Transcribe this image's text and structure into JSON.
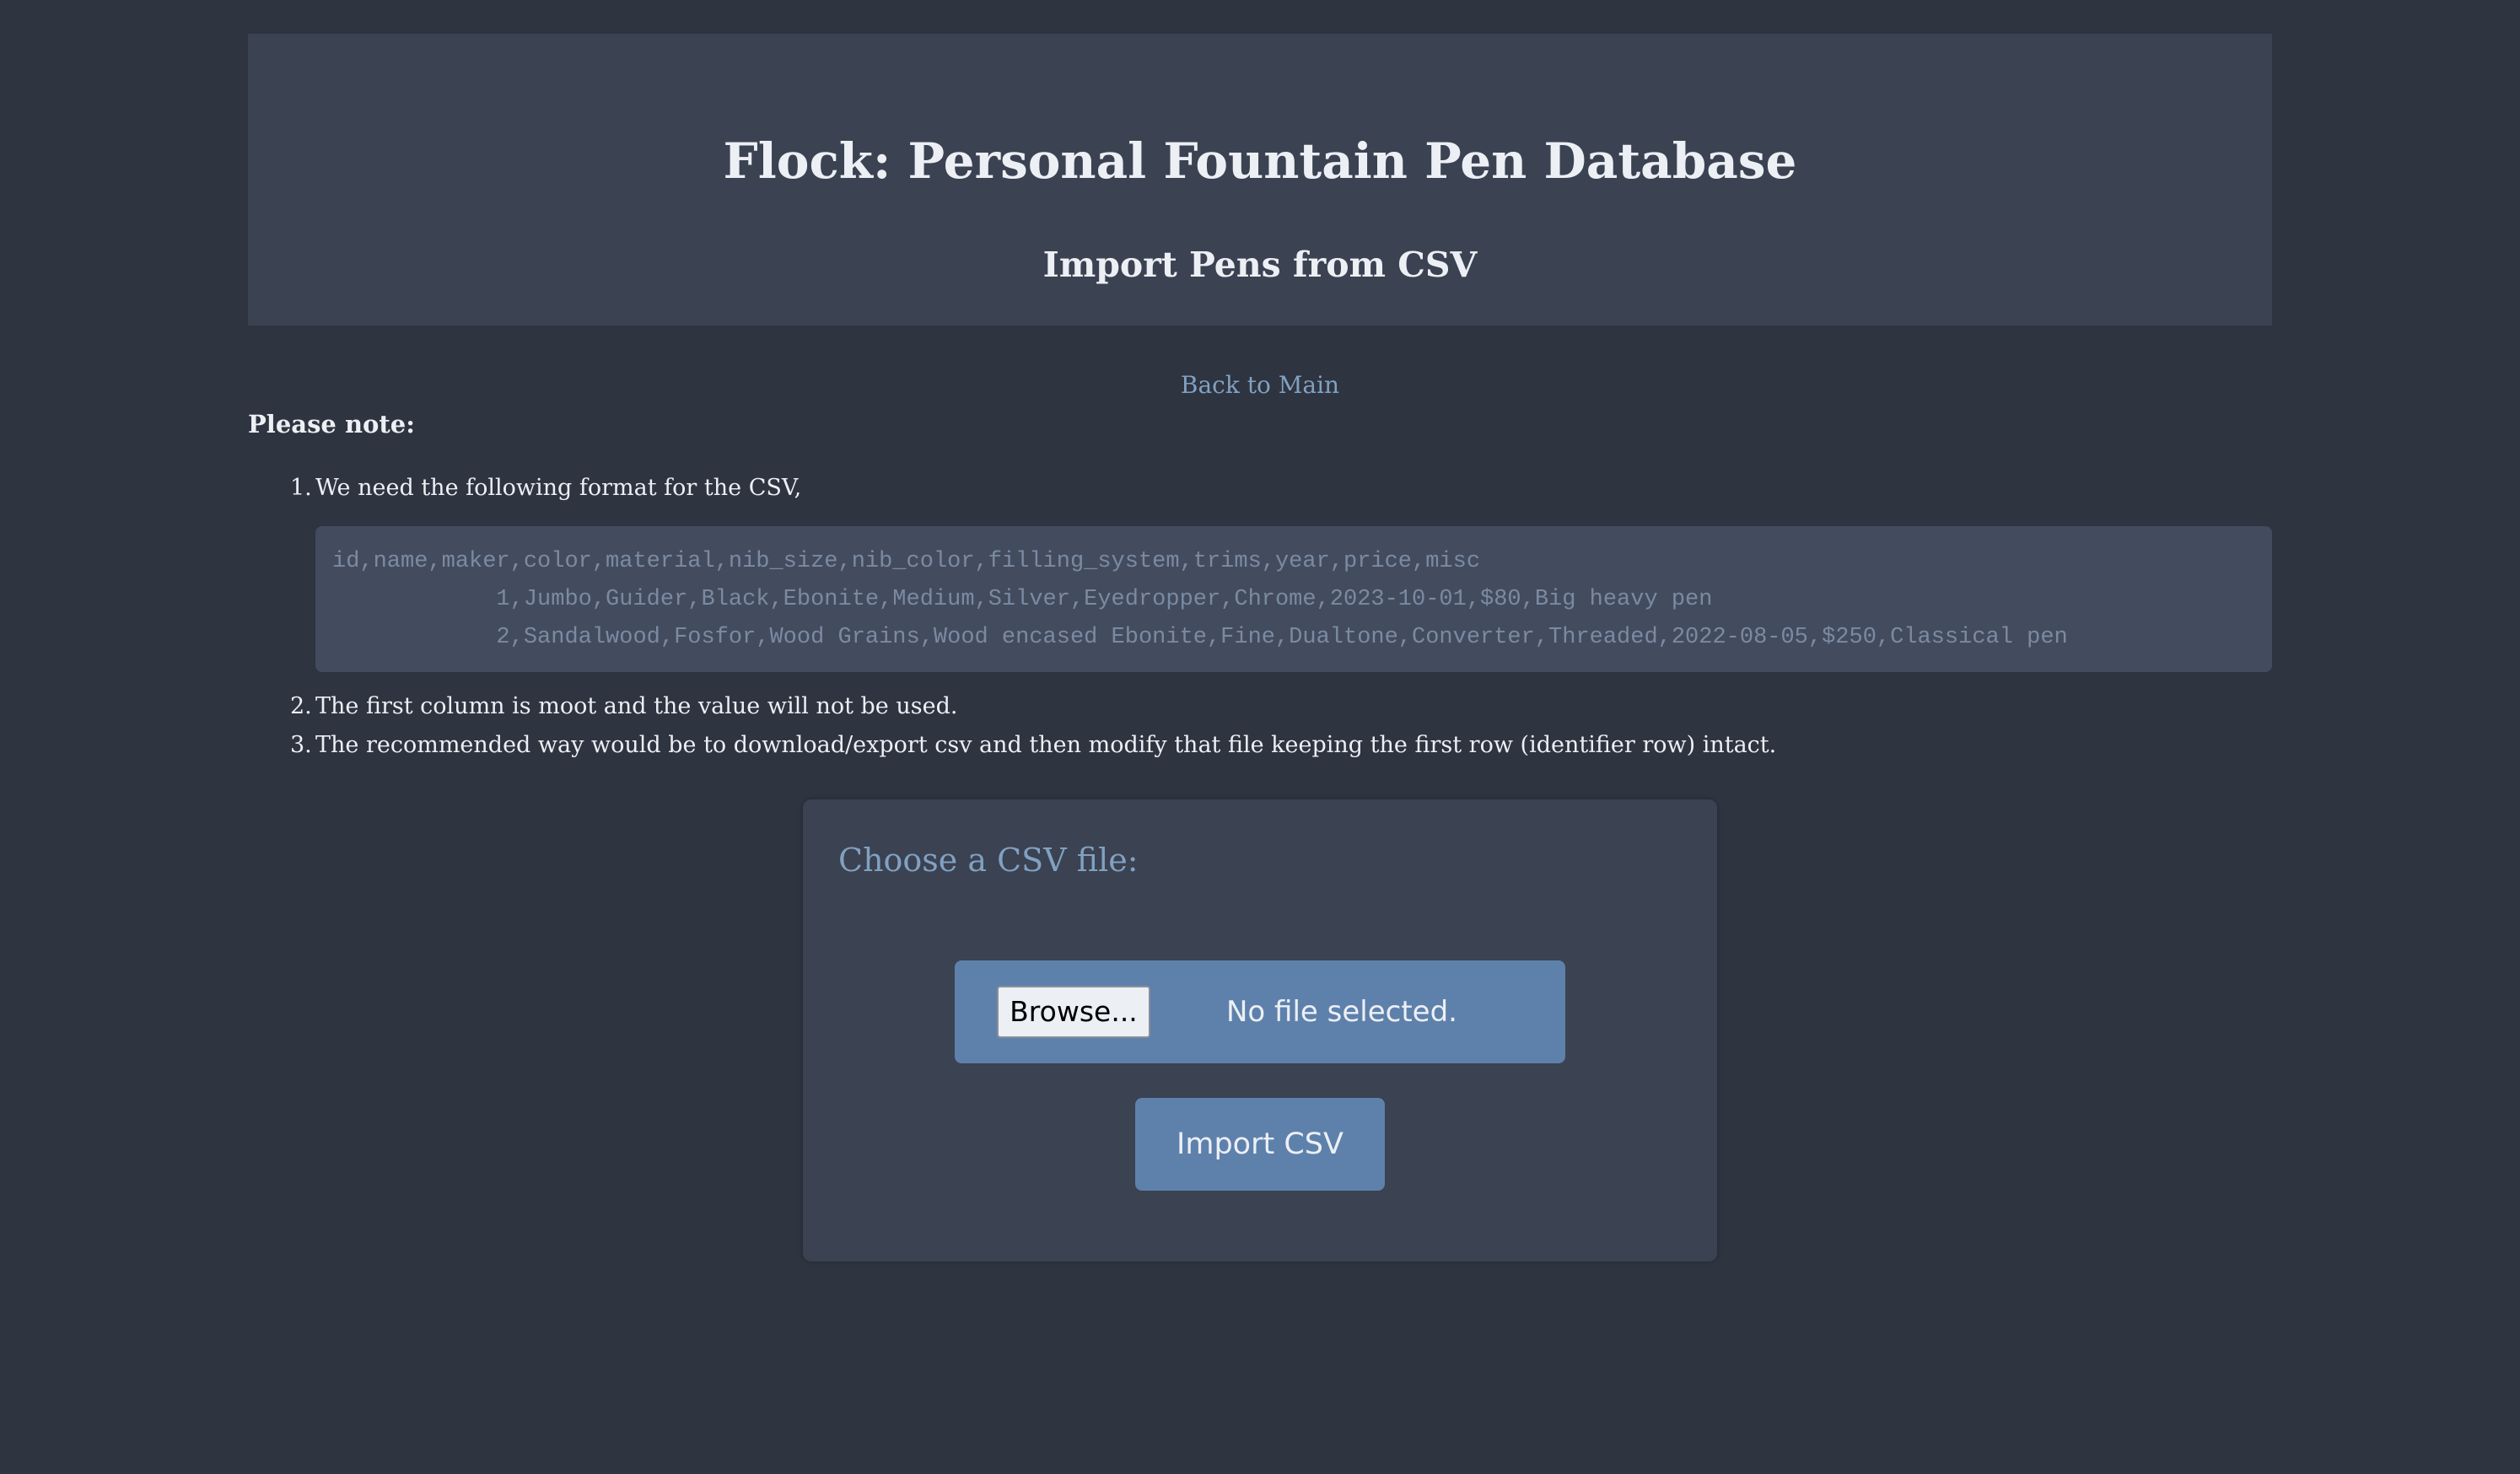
{
  "header": {
    "title": "Flock: Personal Fountain Pen Database",
    "subtitle": "Import Pens from CSV"
  },
  "nav": {
    "back_link": "Back to Main"
  },
  "notes": {
    "title": "Please note:",
    "items": [
      {
        "number": "1.",
        "text": "We need the following format for the CSV,"
      },
      {
        "number": "2.",
        "text": "The first column is moot and the value will not be used."
      },
      {
        "number": "3.",
        "text": "The recommended way would be to download/export csv and then modify that file keeping the first row (identifier row) intact."
      }
    ],
    "code_lines": [
      "id,name,maker,color,material,nib_size,nib_color,filling_system,trims,year,price,misc",
      "            1,Jumbo,Guider,Black,Ebonite,Medium,Silver,Eyedropper,Chrome,2023-10-01,$80,Big heavy pen",
      "            2,Sandalwood,Fosfor,Wood Grains,Wood encased Ebonite,Fine,Dualtone,Converter,Threaded,2022-08-05,$250,Classical pen"
    ]
  },
  "upload": {
    "label": "Choose a CSV file:",
    "browse_label": "Browse...",
    "file_status": "No file selected.",
    "submit_label": "Import CSV"
  },
  "colors": {
    "background": "#2e3440",
    "panel": "#3b4252",
    "code_background": "#434c5e",
    "accent": "#5e81ac",
    "link": "#81a1c1",
    "text": "#eceff4"
  }
}
